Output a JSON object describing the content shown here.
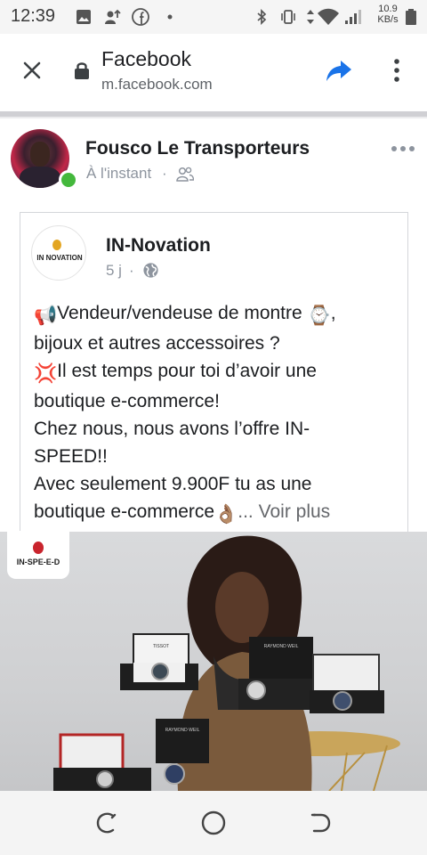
{
  "status_bar": {
    "time": "12:39",
    "speed_value": "10.9",
    "speed_unit": "KB/s",
    "icons": [
      "image-icon",
      "user-upload-icon",
      "facebook-icon",
      "dot-icon",
      "bluetooth-icon",
      "vibrate-icon",
      "data-arrows-icon",
      "wifi-icon",
      "signal-icon",
      "battery-icon"
    ]
  },
  "browser": {
    "title": "Facebook",
    "url": "m.facebook.com",
    "icons": [
      "close-icon",
      "lock-icon",
      "share-icon",
      "more-vert-icon"
    ],
    "accent_color": "#1a73e8"
  },
  "post": {
    "author": "Fousco Le Transporteurs",
    "time": "À l'instant",
    "separator": "·",
    "online_color": "#44b83c"
  },
  "shared": {
    "page_name": "IN-Novation",
    "logo_text": "IN NOVATION",
    "time": "5 j",
    "separator": "·",
    "text_lines": [
      "Vendeur/vendeuse de montre ",
      ",",
      "bijoux et autres accessoires ?",
      "Il est temps pour toi d’avoir une",
      "boutique e-commerce!",
      "Chez nous, nous avons l’offre IN-",
      "SPEED!!",
      "Avec seulement 9.900F tu as une",
      "boutique e-commerce",
      "..."
    ],
    "see_more": "Voir plus",
    "emojis": {
      "megaphone": "📢",
      "watch": "⌚",
      "anger": "💢",
      "ok_hand": "👌🏽"
    }
  },
  "photo": {
    "badge_text": "IN-SPE-E-D",
    "boxes": [
      {
        "brand": "TISSOT"
      },
      {
        "brand": "RAYMOND WEIL"
      },
      {
        "brand": "TISSOT"
      },
      {
        "brand": "RAYMOND WEIL"
      }
    ]
  },
  "nav_bar": {
    "icons": [
      "recents-icon",
      "home-icon",
      "back-icon"
    ]
  }
}
